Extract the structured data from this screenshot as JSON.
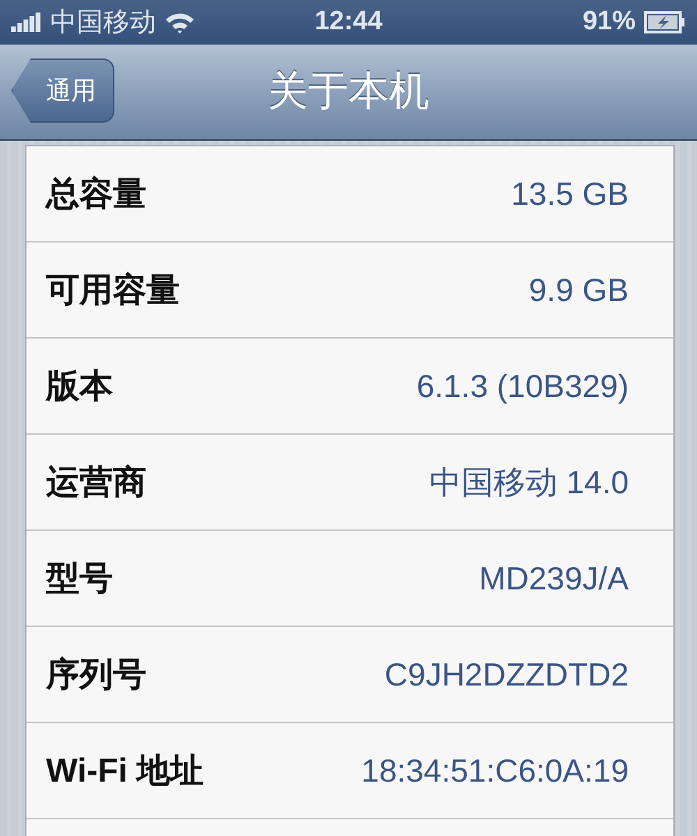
{
  "status_bar": {
    "carrier": "中国移动",
    "time": "12:44",
    "battery": "91%"
  },
  "nav_bar": {
    "back": "通用",
    "title": "关于本机"
  },
  "rows": [
    {
      "label": "总容量",
      "value": "13.5 GB"
    },
    {
      "label": "可用容量",
      "value": "9.9 GB"
    },
    {
      "label": "版本",
      "value": "6.1.3 (10B329)"
    },
    {
      "label": "运营商",
      "value": "中国移动 14.0"
    },
    {
      "label": "型号",
      "value": "MD239J/A"
    },
    {
      "label": "序列号",
      "value": "C9JH2DZZDTD2"
    },
    {
      "label": "Wi-Fi 地址",
      "value": "18:34:51:C6:0A:19"
    }
  ]
}
